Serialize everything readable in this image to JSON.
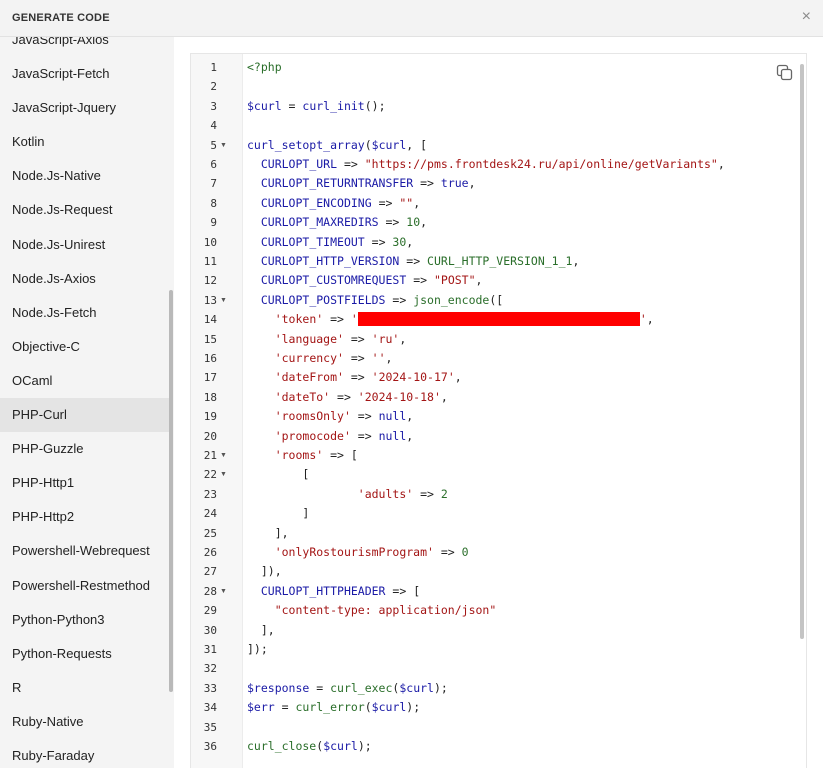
{
  "dialog": {
    "title": "GENERATE CODE",
    "close_glyph": "×"
  },
  "sidebar": {
    "items": [
      {
        "label": "JavaScript-Axios",
        "active": false
      },
      {
        "label": "JavaScript-Fetch",
        "active": false
      },
      {
        "label": "JavaScript-Jquery",
        "active": false
      },
      {
        "label": "Kotlin",
        "active": false
      },
      {
        "label": "Node.Js-Native",
        "active": false
      },
      {
        "label": "Node.Js-Request",
        "active": false
      },
      {
        "label": "Node.Js-Unirest",
        "active": false
      },
      {
        "label": "Node.Js-Axios",
        "active": false
      },
      {
        "label": "Node.Js-Fetch",
        "active": false
      },
      {
        "label": "Objective-C",
        "active": false
      },
      {
        "label": "OCaml",
        "active": false
      },
      {
        "label": "PHP-Curl",
        "active": true
      },
      {
        "label": "PHP-Guzzle",
        "active": false
      },
      {
        "label": "PHP-Http1",
        "active": false
      },
      {
        "label": "PHP-Http2",
        "active": false
      },
      {
        "label": "Powershell-Webrequest",
        "active": false
      },
      {
        "label": "Powershell-Restmethod",
        "active": false
      },
      {
        "label": "Python-Python3",
        "active": false
      },
      {
        "label": "Python-Requests",
        "active": false
      },
      {
        "label": "R",
        "active": false
      },
      {
        "label": "Ruby-Native",
        "active": false
      },
      {
        "label": "Ruby-Faraday",
        "active": false
      }
    ]
  },
  "editor": {
    "copy_icon": "copy-icon",
    "fold_lines": [
      5,
      13,
      21,
      22,
      28
    ],
    "lines": [
      [
        [
          "php",
          "<?php"
        ]
      ],
      [],
      [
        [
          "var",
          "$curl"
        ],
        [
          "op",
          " = "
        ],
        [
          "fn",
          "curl_init"
        ],
        [
          "punc",
          "();"
        ]
      ],
      [],
      [
        [
          "fn",
          "curl_setopt_array"
        ],
        [
          "punc",
          "("
        ],
        [
          "var",
          "$curl"
        ],
        [
          "punc",
          ", ["
        ]
      ],
      [
        [
          "punc",
          "  "
        ],
        [
          "const",
          "CURLOPT_URL"
        ],
        [
          "op",
          " => "
        ],
        [
          "str",
          "\"https://pms.frontdesk24.ru/api/online/getVariants\""
        ],
        [
          "punc",
          ","
        ]
      ],
      [
        [
          "punc",
          "  "
        ],
        [
          "const",
          "CURLOPT_RETURNTRANSFER"
        ],
        [
          "op",
          " => "
        ],
        [
          "const",
          "true"
        ],
        [
          "punc",
          ","
        ]
      ],
      [
        [
          "punc",
          "  "
        ],
        [
          "const",
          "CURLOPT_ENCODING"
        ],
        [
          "op",
          " => "
        ],
        [
          "str",
          "\"\""
        ],
        [
          "punc",
          ","
        ]
      ],
      [
        [
          "punc",
          "  "
        ],
        [
          "const",
          "CURLOPT_MAXREDIRS"
        ],
        [
          "op",
          " => "
        ],
        [
          "num",
          "10"
        ],
        [
          "punc",
          ","
        ]
      ],
      [
        [
          "punc",
          "  "
        ],
        [
          "const",
          "CURLOPT_TIMEOUT"
        ],
        [
          "op",
          " => "
        ],
        [
          "num",
          "30"
        ],
        [
          "punc",
          ","
        ]
      ],
      [
        [
          "punc",
          "  "
        ],
        [
          "const",
          "CURLOPT_HTTP_VERSION"
        ],
        [
          "op",
          " => "
        ],
        [
          "kw",
          "CURL_HTTP_VERSION_1_1"
        ],
        [
          "punc",
          ","
        ]
      ],
      [
        [
          "punc",
          "  "
        ],
        [
          "const",
          "CURLOPT_CUSTOMREQUEST"
        ],
        [
          "op",
          " => "
        ],
        [
          "str",
          "\"POST\""
        ],
        [
          "punc",
          ","
        ]
      ],
      [
        [
          "punc",
          "  "
        ],
        [
          "const",
          "CURLOPT_POSTFIELDS"
        ],
        [
          "op",
          " => "
        ],
        [
          "kw",
          "json_encode"
        ],
        [
          "punc",
          "(["
        ]
      ],
      [
        [
          "punc",
          "    "
        ],
        [
          "str",
          "'token'"
        ],
        [
          "op",
          " => "
        ],
        [
          "str",
          "'"
        ],
        [
          "redact",
          ""
        ],
        [
          "str",
          "'"
        ],
        [
          "punc",
          ","
        ]
      ],
      [
        [
          "punc",
          "    "
        ],
        [
          "str",
          "'language'"
        ],
        [
          "op",
          " => "
        ],
        [
          "str",
          "'ru'"
        ],
        [
          "punc",
          ","
        ]
      ],
      [
        [
          "punc",
          "    "
        ],
        [
          "str",
          "'currency'"
        ],
        [
          "op",
          " => "
        ],
        [
          "str",
          "''"
        ],
        [
          "punc",
          ","
        ]
      ],
      [
        [
          "punc",
          "    "
        ],
        [
          "str",
          "'dateFrom'"
        ],
        [
          "op",
          " => "
        ],
        [
          "str",
          "'2024-10-17'"
        ],
        [
          "punc",
          ","
        ]
      ],
      [
        [
          "punc",
          "    "
        ],
        [
          "str",
          "'dateTo'"
        ],
        [
          "op",
          " => "
        ],
        [
          "str",
          "'2024-10-18'"
        ],
        [
          "punc",
          ","
        ]
      ],
      [
        [
          "punc",
          "    "
        ],
        [
          "str",
          "'roomsOnly'"
        ],
        [
          "op",
          " => "
        ],
        [
          "const",
          "null"
        ],
        [
          "punc",
          ","
        ]
      ],
      [
        [
          "punc",
          "    "
        ],
        [
          "str",
          "'promocode'"
        ],
        [
          "op",
          " => "
        ],
        [
          "const",
          "null"
        ],
        [
          "punc",
          ","
        ]
      ],
      [
        [
          "punc",
          "    "
        ],
        [
          "str",
          "'rooms'"
        ],
        [
          "op",
          " => "
        ],
        [
          "punc",
          "["
        ]
      ],
      [
        [
          "punc",
          "        ["
        ]
      ],
      [
        [
          "punc",
          "                "
        ],
        [
          "str",
          "'adults'"
        ],
        [
          "op",
          " => "
        ],
        [
          "num",
          "2"
        ]
      ],
      [
        [
          "punc",
          "        ]"
        ]
      ],
      [
        [
          "punc",
          "    ],"
        ]
      ],
      [
        [
          "punc",
          "    "
        ],
        [
          "str",
          "'onlyRostourismProgram'"
        ],
        [
          "op",
          " => "
        ],
        [
          "num",
          "0"
        ]
      ],
      [
        [
          "punc",
          "  ]),"
        ]
      ],
      [
        [
          "punc",
          "  "
        ],
        [
          "const",
          "CURLOPT_HTTPHEADER"
        ],
        [
          "op",
          " => "
        ],
        [
          "punc",
          "["
        ]
      ],
      [
        [
          "punc",
          "    "
        ],
        [
          "str",
          "\"content-type: application/json\""
        ]
      ],
      [
        [
          "punc",
          "  ],"
        ]
      ],
      [
        [
          "punc",
          "]);"
        ]
      ],
      [],
      [
        [
          "var",
          "$response"
        ],
        [
          "op",
          " = "
        ],
        [
          "kw",
          "curl_exec"
        ],
        [
          "punc",
          "("
        ],
        [
          "var",
          "$curl"
        ],
        [
          "punc",
          ");"
        ]
      ],
      [
        [
          "var",
          "$err"
        ],
        [
          "op",
          " = "
        ],
        [
          "kw",
          "curl_error"
        ],
        [
          "punc",
          "("
        ],
        [
          "var",
          "$curl"
        ],
        [
          "punc",
          ");"
        ]
      ],
      [],
      [
        [
          "kw",
          "curl_close"
        ],
        [
          "punc",
          "("
        ],
        [
          "var",
          "$curl"
        ],
        [
          "punc",
          ");"
        ]
      ]
    ]
  }
}
